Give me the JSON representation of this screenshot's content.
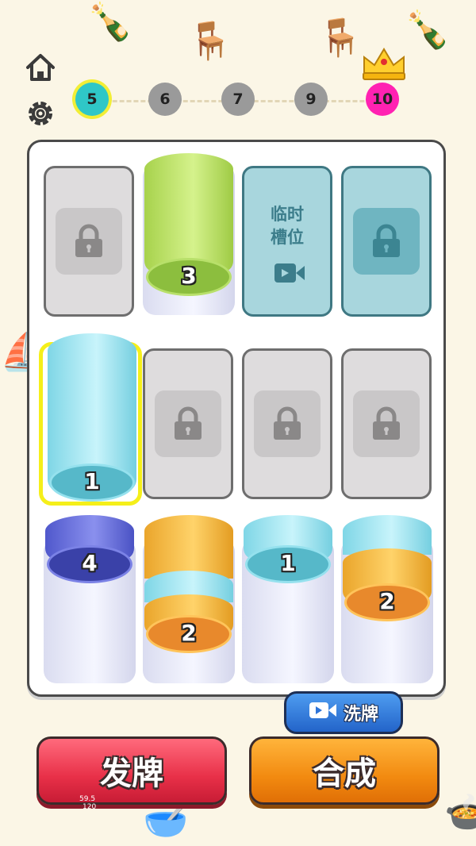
{
  "levels": [
    {
      "label": "5",
      "color": "#2fc7c7",
      "current": true
    },
    {
      "label": "6",
      "color": "#9a9a9a"
    },
    {
      "label": "7",
      "color": "#9a9a9a"
    },
    {
      "label": "9",
      "color": "#9a9a9a"
    },
    {
      "label": "10",
      "color": "#ff22b2",
      "boss": true
    }
  ],
  "temp_slot": {
    "label_line1": "临时",
    "label_line2": "槽位"
  },
  "stacks": {
    "green": {
      "number": "3"
    },
    "selected": {
      "number": "1"
    },
    "blue": {
      "number": "4"
    },
    "orange_mix": {
      "number": "2"
    },
    "cyan": {
      "number": "1"
    },
    "orange_top": {
      "number": "2"
    }
  },
  "colors": {
    "green": "#b6e05a",
    "cyan": "#8ee4f2",
    "blue": "#5860d8",
    "orange": "#f6b53a",
    "selected_border": "#f5ef1a"
  },
  "buttons": {
    "deal": "发牌",
    "merge": "合成",
    "shuffle": "洗牌"
  },
  "debug": {
    "line1": "59.5",
    "line2": "120"
  }
}
